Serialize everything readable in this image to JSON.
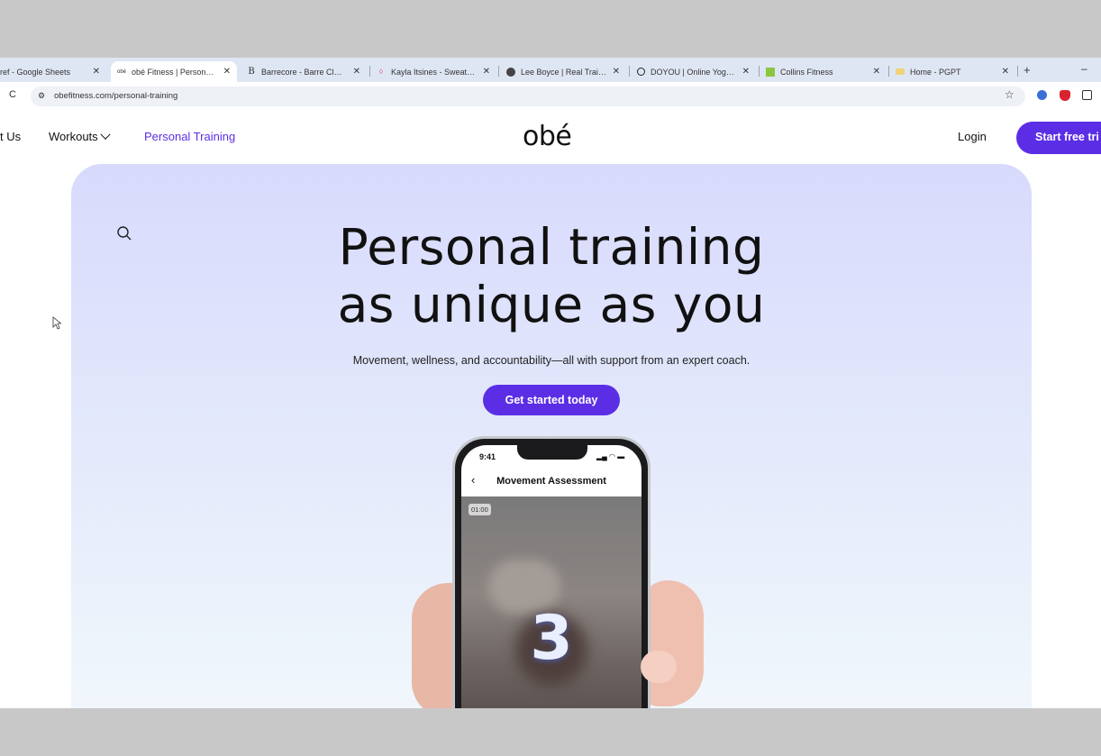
{
  "browser": {
    "tabs": [
      {
        "title": "ref - Google Sheets",
        "favicon": "sheets-icon",
        "active": false
      },
      {
        "title": "obé Fitness | Personalized",
        "favicon": "obe-icon",
        "active": true
      },
      {
        "title": "Barrecore - Barre Classes",
        "favicon": "B",
        "active": false
      },
      {
        "title": "Kayla Itsines - Sweat Co-f",
        "favicon": "drop-icon",
        "active": false
      },
      {
        "title": "Lee Boyce | Real Training",
        "favicon": "avatar-icon",
        "active": false
      },
      {
        "title": "DOYOU | Online Yoga, Fit",
        "favicon": "O",
        "active": false
      },
      {
        "title": "Collins Fitness",
        "favicon": "green-square-icon",
        "active": false
      },
      {
        "title": "Home - PGPT",
        "favicon": "card-icon",
        "active": false
      }
    ],
    "url": "obefitness.com/personal-training"
  },
  "nav": {
    "about_partial": "t Us",
    "workouts": "Workouts",
    "personal_training": "Personal Training",
    "logo": "obé",
    "login": "Login",
    "trial": "Start free tri"
  },
  "hero": {
    "headline_line1": "Personal training",
    "headline_line2": "as unique as you",
    "subline": "Movement, wellness, and accountability—all with support from an expert coach.",
    "cta": "Get started today"
  },
  "phone": {
    "time": "9:41",
    "title": "Movement Assessment",
    "timer": "01:00",
    "countdown": "3"
  },
  "colors": {
    "accent": "#5b2ee6",
    "hero_top": "#d8dafc",
    "hero_bottom": "#f2f8fc"
  }
}
